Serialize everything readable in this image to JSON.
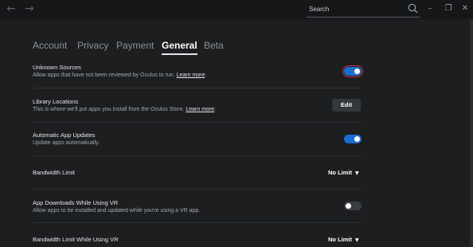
{
  "titlebar": {
    "back_icon": "arrow-left-icon",
    "forward_icon": "arrow-right-icon",
    "search": {
      "placeholder": "Search",
      "value": ""
    },
    "window_controls": {
      "minimize": "–",
      "restore": "❐",
      "close": "✕"
    }
  },
  "tabs": [
    {
      "label": "Account",
      "active": false
    },
    {
      "label": "Privacy",
      "active": false
    },
    {
      "label": "Payment",
      "active": false
    },
    {
      "label": "General",
      "active": true
    },
    {
      "label": "Beta",
      "active": false
    }
  ],
  "settings": {
    "unknown_sources": {
      "title": "Unknown Sources",
      "description": "Allow apps that have not been reviewed by Oculus to run.",
      "link": "Learn more",
      "suffix": ".",
      "enabled": true
    },
    "library_locations": {
      "title": "Library Locations",
      "description": "This is where we'll put apps you install from the Oculus Store.",
      "link": "Learn more",
      "suffix": ".",
      "button_label": "Edit"
    },
    "automatic_updates": {
      "title": "Automatic App Updates",
      "description": "Update apps automatically.",
      "enabled": true
    },
    "bandwidth_limit": {
      "title": "Bandwidth Limit",
      "value": "No Limit"
    },
    "downloads_while_vr": {
      "title": "App Downloads While Using VR",
      "description": "Allow apps to be installed and updated while you're using a VR app.",
      "enabled": false
    },
    "bandwidth_limit_vr": {
      "title": "Bandwidth Limit While Using VR",
      "value": "No Limit"
    }
  },
  "colors": {
    "background": "#1c1e20",
    "titlebar": "#151719",
    "toggle_on": "#1b6ed1",
    "toggle_off": "#3b3e42",
    "focus_ring": "#d23242"
  }
}
